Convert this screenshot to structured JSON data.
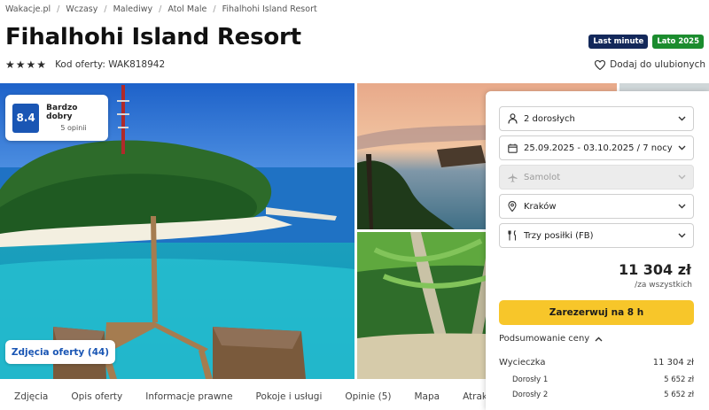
{
  "breadcrumb": [
    "Wakacje.pl",
    "Wczasy",
    "Malediwy",
    "Atol Male",
    "Fihalhohi Island Resort"
  ],
  "title": "Fihalhohi Island Resort",
  "badges": {
    "last_minute": "Last minute",
    "season": "Lato 2025"
  },
  "offer_code": "Kod oferty: WAK818942",
  "stars": 4,
  "favorite_label": "Dodaj do ulubionych",
  "rating": {
    "score": "8.4",
    "label": "Bardzo dobry",
    "count": "5 opinii"
  },
  "photos_button": "Zdjęcia oferty (44)",
  "booking": {
    "guests": "2 dorosłych",
    "dates": "25.09.2025 - 03.10.2025 / 7 nocy",
    "transport": "Samolot",
    "departure": "Kraków",
    "board": "Trzy posiłki (FB)",
    "price": "11 304 zł",
    "price_note": "/za wszystkich",
    "reserve_label": "Zarezerwuj na 8 h",
    "summary_title": "Podsumowanie ceny",
    "summary": {
      "trip_label": "Wycieczka",
      "trip_value": "11 304 zł",
      "adult1_label": "Dorosły 1",
      "adult1_value": "5 652 zł",
      "adult2_label": "Dorosły 2",
      "adult2_value": "5 652 zł"
    }
  },
  "tabs": [
    "Zdjęcia",
    "Opis oferty",
    "Informacje prawne",
    "Pokoje i usługi",
    "Opinie (5)",
    "Mapa",
    "Atrakcje"
  ],
  "icons": {
    "star": "star-icon",
    "heart": "heart-icon",
    "person": "person-icon",
    "calendar": "calendar-icon",
    "plane": "plane-icon",
    "location": "location-pin-icon",
    "cutlery": "cutlery-icon",
    "chevron_down": "chevron-down-icon",
    "chevron_up": "chevron-up-icon"
  },
  "colors": {
    "brand_blue": "#1a56b4",
    "reserve_yellow": "#f7c62a",
    "last_minute_bg": "#13285a",
    "season_bg": "#1b8c2e"
  }
}
